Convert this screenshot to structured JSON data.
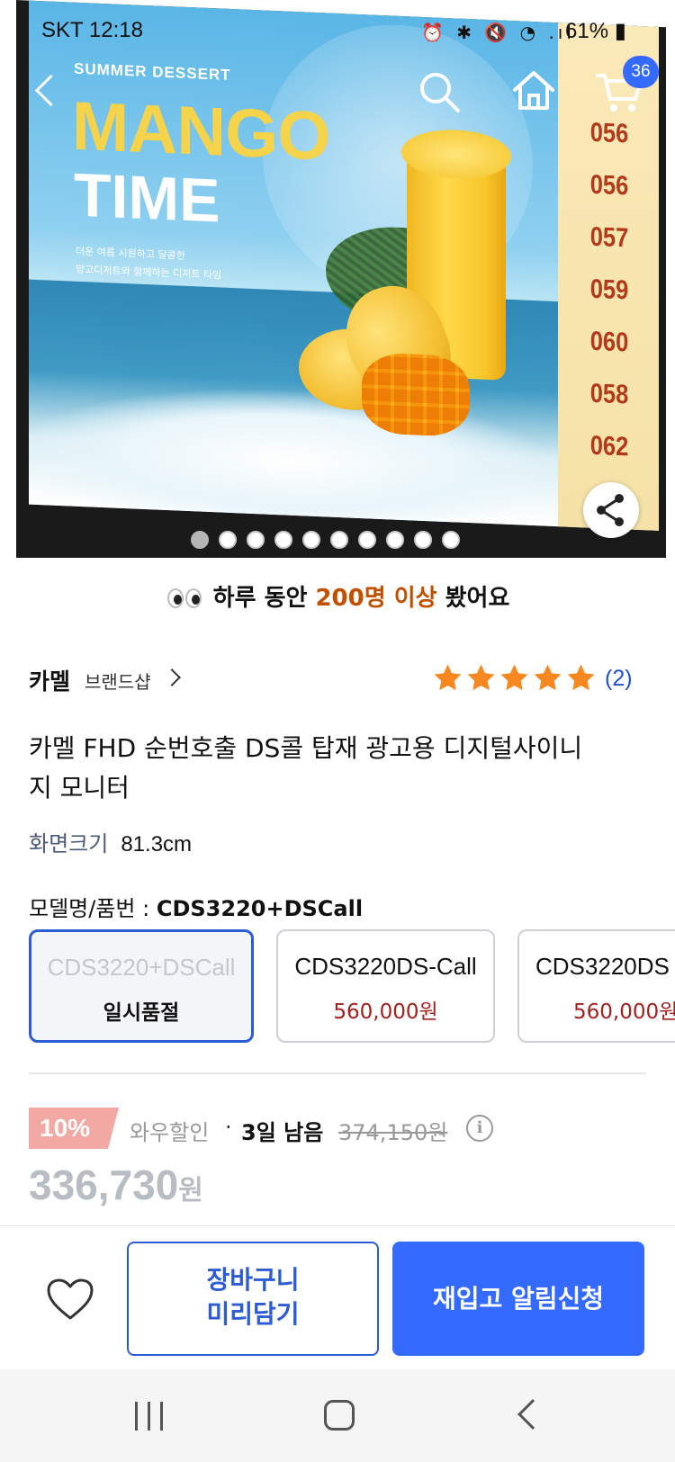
{
  "status_bar": {
    "carrier_time": "SKT 12:18",
    "icons": "⏰ ✱ 🔇 ◔ .ıl",
    "battery": "61%"
  },
  "hero": {
    "ad_small": "SUMMER DESSERT",
    "ad_title_1": "MANGO",
    "ad_title_2": "TIME",
    "ad_sub_1": "더운 여름 시원하고 달콤한",
    "ad_sub_2": "망고디저트와 함께하는 디저트 타임",
    "numbers": [
      "056",
      "056",
      "057",
      "059",
      "060",
      "058",
      "062"
    ],
    "cart_count": "36",
    "slides_total": 10,
    "slide_active": 1
  },
  "viewed": {
    "prefix": "하루 동안 ",
    "highlight": "200명 이상",
    "suffix": " 봤어요"
  },
  "brand": {
    "name": "카멜",
    "shop_link": "브랜드샵",
    "rating_stars": 5,
    "review_count": "(2)"
  },
  "product": {
    "title": "카멜 FHD 순번호출 DS콜 탑재 광고용 디지털사이니지 모니터",
    "spec_key": "화면크기",
    "spec_value": "81.3cm",
    "model_label": "모델명/품번 : ",
    "model_value": "CDS3220+DSCall"
  },
  "options": [
    {
      "name": "CDS3220+DSCall",
      "price": "일시품절"
    },
    {
      "name": "CDS3220DS-Call",
      "price": "560,000원"
    },
    {
      "name": "CDS3220DS",
      "price": "560,000원"
    }
  ],
  "discount": {
    "rate": "10%",
    "type": "와우할인",
    "sep": "·",
    "remaining": "3일 남음",
    "original": "374,150원",
    "info_icon": "i"
  },
  "price": {
    "amount": "336,730",
    "unit": "원"
  },
  "actions": {
    "cart_line1": "장바구니",
    "cart_line2": "미리담기",
    "restock": "재입고 알림신청"
  },
  "colors": {
    "accent": "#346aff",
    "highlight": "#c24f00",
    "star": "#f6881f",
    "price_red": "#a3201c"
  }
}
